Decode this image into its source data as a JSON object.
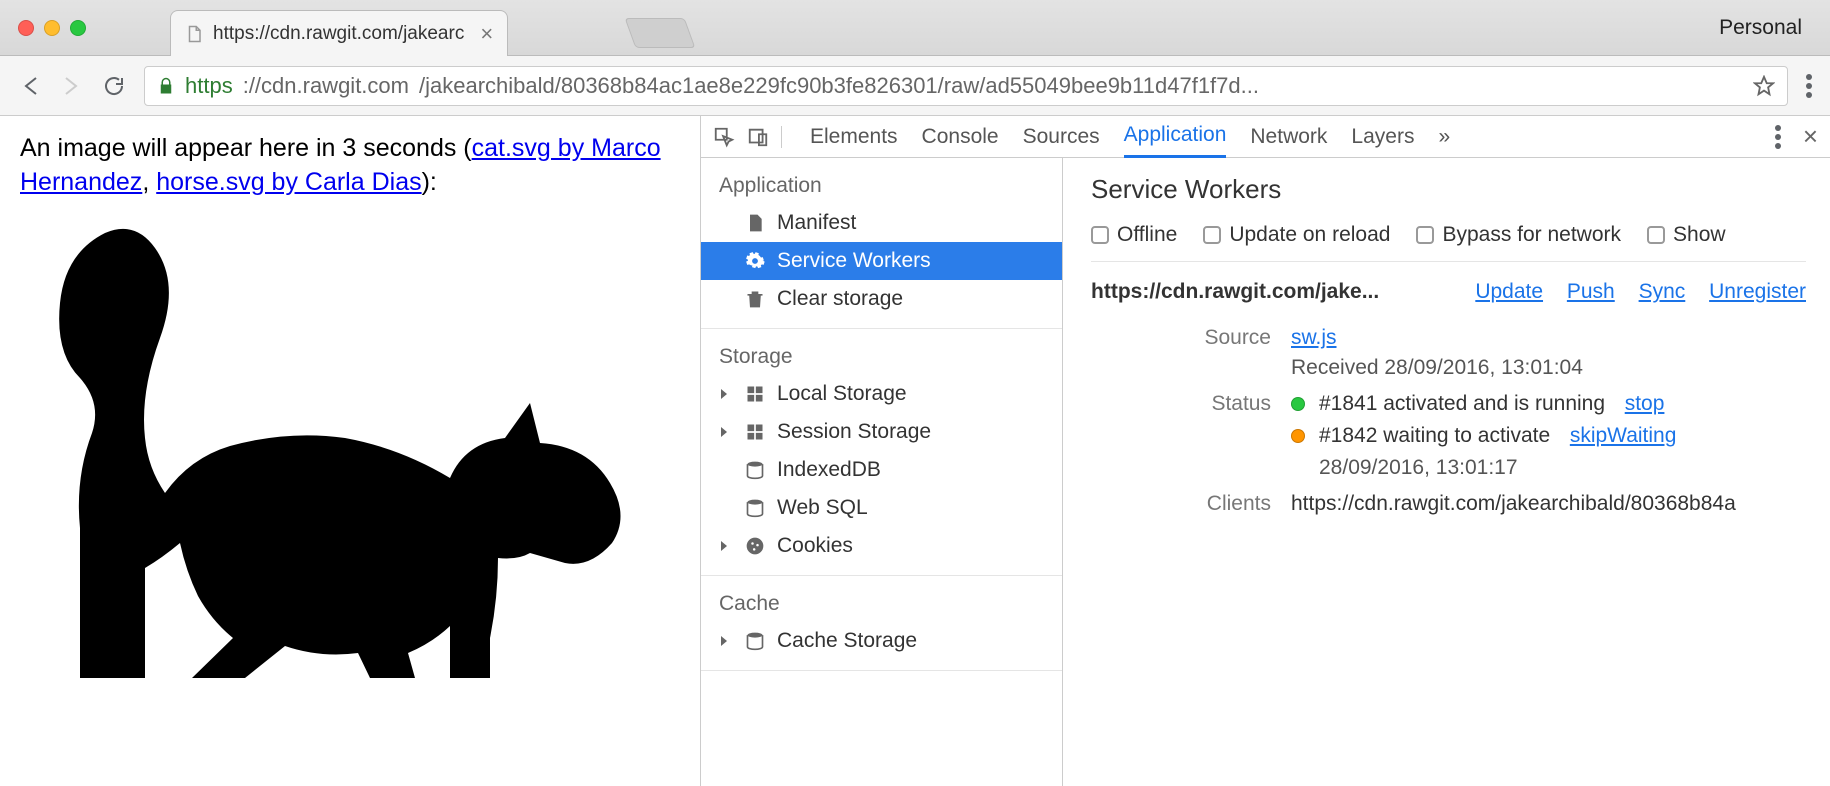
{
  "browser": {
    "tab_title": "https://cdn.rawgit.com/jakearc",
    "personal_label": "Personal",
    "url_scheme": "https",
    "url_host": "://cdn.rawgit.com",
    "url_path": "/jakearchibald/80368b84ac1ae8e229fc90b3fe826301/raw/ad55049bee9b11d47f1f7d..."
  },
  "page": {
    "prefix": "An image will appear here in 3 seconds (",
    "link1": "cat.svg by Marco Hernandez",
    "sep": ", ",
    "link2": "horse.svg by Carla Dias",
    "suffix": "):"
  },
  "devtools": {
    "tabs": [
      "Elements",
      "Console",
      "Sources",
      "Application",
      "Network",
      "Layers"
    ],
    "active_tab": "Application"
  },
  "sidebar": {
    "application": {
      "label": "Application",
      "items": [
        "Manifest",
        "Service Workers",
        "Clear storage"
      ],
      "selected": "Service Workers"
    },
    "storage": {
      "label": "Storage",
      "items": [
        "Local Storage",
        "Session Storage",
        "IndexedDB",
        "Web SQL",
        "Cookies"
      ]
    },
    "cache": {
      "label": "Cache",
      "items": [
        "Cache Storage"
      ]
    }
  },
  "panel": {
    "title": "Service Workers",
    "checks": [
      "Offline",
      "Update on reload",
      "Bypass for network",
      "Show"
    ],
    "origin": "https://cdn.rawgit.com/jake...",
    "actions": [
      "Update",
      "Push",
      "Sync",
      "Unregister"
    ],
    "source": {
      "label": "Source",
      "file": "sw.js",
      "received": "Received 28/09/2016, 13:01:04"
    },
    "status": {
      "label": "Status",
      "rows": [
        {
          "dot": "green",
          "text": "#1841 activated and is running",
          "action": "stop"
        },
        {
          "dot": "orange",
          "text": "#1842 waiting to activate",
          "action": "skipWaiting",
          "time": "28/09/2016, 13:01:17"
        }
      ]
    },
    "clients": {
      "label": "Clients",
      "url": "https://cdn.rawgit.com/jakearchibald/80368b84a"
    }
  }
}
